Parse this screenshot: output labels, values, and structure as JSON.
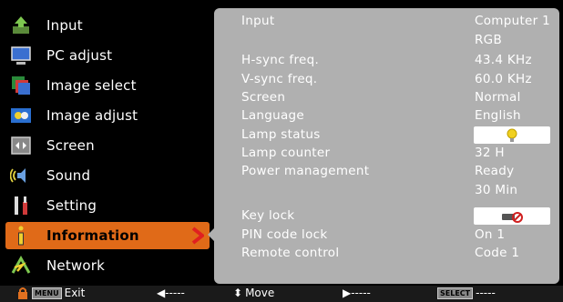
{
  "menu": {
    "items": [
      {
        "label": "Input",
        "icon": "input-icon"
      },
      {
        "label": "PC adjust",
        "icon": "monitor-icon"
      },
      {
        "label": "Image select",
        "icon": "image-select-icon"
      },
      {
        "label": "Image adjust",
        "icon": "image-adjust-icon"
      },
      {
        "label": "Screen",
        "icon": "screen-icon"
      },
      {
        "label": "Sound",
        "icon": "sound-icon"
      },
      {
        "label": "Setting",
        "icon": "setting-icon"
      },
      {
        "label": "Information",
        "icon": "information-icon",
        "selected": true
      },
      {
        "label": "Network",
        "icon": "network-icon"
      }
    ],
    "selected_color": "#e06a18"
  },
  "info": {
    "input_label": "Input",
    "input_value": "Computer 1",
    "input_value2": "RGB",
    "hsync_label": "H-sync freq.",
    "hsync_value": "43.4  KHz",
    "vsync_label": "V-sync freq.",
    "vsync_value": "60.0  KHz",
    "screen_label": "Screen",
    "screen_value": "Normal",
    "language_label": "Language",
    "language_value": "English",
    "lamp_status_label": "Lamp status",
    "lamp_status_icon": "lamp-icon",
    "lamp_counter_label": "Lamp counter",
    "lamp_counter_value": "32  H",
    "power_mgmt_label": "Power management",
    "power_mgmt_value": "Ready",
    "power_mgmt_value2": "30 Min",
    "key_lock_label": "Key lock",
    "key_lock_icon": "key-lock-icon",
    "pin_lock_label": "PIN code lock",
    "pin_lock_value": "On 1",
    "remote_label": "Remote control",
    "remote_value": "Code 1"
  },
  "bottombar": {
    "menu_key": "MENU",
    "exit_label": "Exit",
    "left_label": "◀-----",
    "move_label": "Move",
    "right_label": "▶-----",
    "select_key": "SELECT",
    "select_label": "-----"
  }
}
